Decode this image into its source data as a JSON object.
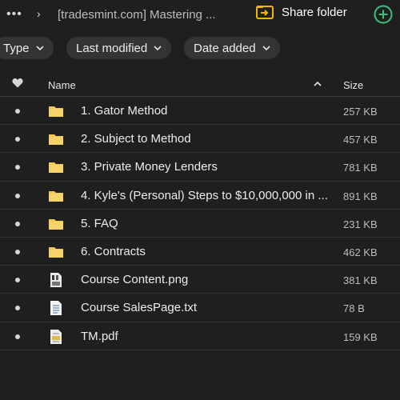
{
  "topbar": {
    "more_icon": "ellipsis-icon",
    "chevron_icon": "chevron-right-icon",
    "breadcrumb": "[tradesmint.com] Mastering ...",
    "share_label": "Share folder",
    "share_icon": "share-folder-icon",
    "add_icon": "plus-circle-icon",
    "accent": "#f2b600",
    "add_color": "#3cc07a"
  },
  "filters": [
    {
      "label": "Type"
    },
    {
      "label": "Last modified"
    },
    {
      "label": "Date added"
    }
  ],
  "table": {
    "columns": {
      "name": "Name",
      "size": "Size"
    },
    "favorite_icon": "heart-icon",
    "sort": "descending",
    "rows": [
      {
        "name": "1. Gator Method",
        "size": "257 KB",
        "type": "folder"
      },
      {
        "name": "2. Subject to Method",
        "size": "457 KB",
        "type": "folder"
      },
      {
        "name": "3. Private Money Lenders",
        "size": "781 KB",
        "type": "folder"
      },
      {
        "name": "4. Kyle's (Personal) Steps to $10,000,000 in ...",
        "size": "891 KB",
        "type": "folder"
      },
      {
        "name": "5. FAQ",
        "size": "231 KB",
        "type": "folder"
      },
      {
        "name": "6. Contracts",
        "size": "462 KB",
        "type": "folder"
      },
      {
        "name": "Course Content.png",
        "size": "381 KB",
        "type": "image"
      },
      {
        "name": "Course SalesPage.txt",
        "size": "78 B",
        "type": "text"
      },
      {
        "name": "TM.pdf",
        "size": "159 KB",
        "type": "pdf"
      }
    ]
  },
  "colors": {
    "background": "#1f1f1f",
    "folder": "#f2c94c",
    "chip": "#343434"
  }
}
